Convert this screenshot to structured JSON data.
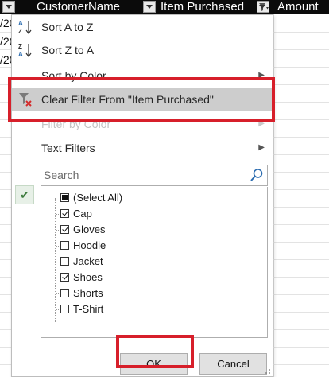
{
  "sheet": {
    "headers": [
      "CustomerName",
      "Item Purchased",
      "Amount"
    ],
    "cell_fragments": [
      "/20",
      "/20",
      "/20"
    ]
  },
  "menu": {
    "sort_az": "Sort A to Z",
    "sort_za": "Sort Z to A",
    "sort_by_color": "Sort by Color",
    "clear_filter": "Clear Filter From \"Item Purchased\"",
    "filter_by_color": "Filter by Color",
    "text_filters": "Text Filters"
  },
  "search": {
    "placeholder": "Search",
    "value": ""
  },
  "items": [
    {
      "label": "(Select All)",
      "state": "partial"
    },
    {
      "label": "Cap",
      "state": "checked"
    },
    {
      "label": "Gloves",
      "state": "checked"
    },
    {
      "label": "Hoodie",
      "state": "unchecked"
    },
    {
      "label": "Jacket",
      "state": "unchecked"
    },
    {
      "label": "Shoes",
      "state": "checked"
    },
    {
      "label": "Shorts",
      "state": "unchecked"
    },
    {
      "label": "T-Shirt",
      "state": "unchecked"
    }
  ],
  "buttons": {
    "ok": "OK",
    "cancel": "Cancel"
  },
  "icons": {
    "sort_az": "sort-ascending-icon",
    "sort_za": "sort-descending-icon",
    "clear_filter": "clear-filter-icon",
    "search": "search-icon",
    "submenu": "chevron-right-icon",
    "applied": "checkmark-icon"
  },
  "colors": {
    "header_bg": "#0b0b0b",
    "highlight": "#d71f2a",
    "hover_row": "#cdcdcd",
    "search_icon": "#2b6cb0"
  }
}
